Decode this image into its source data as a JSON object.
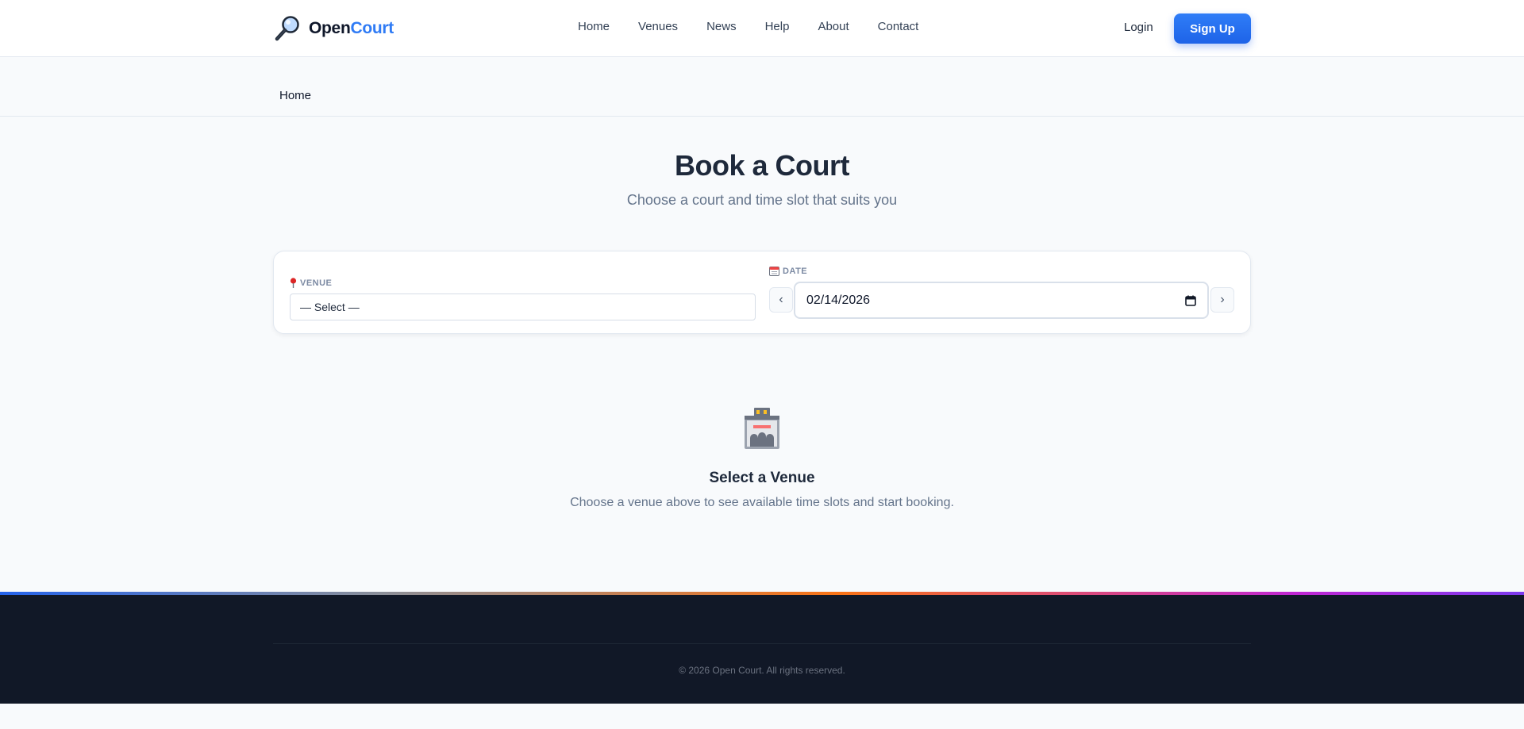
{
  "header": {
    "logo_part1": "Open",
    "logo_part2": "Court",
    "nav": [
      "Home",
      "Venues",
      "News",
      "Help",
      "About",
      "Contact"
    ],
    "login_label": "Login",
    "signup_label": "Sign Up"
  },
  "breadcrumb": {
    "current": "Home"
  },
  "hero": {
    "title": "Book a Court",
    "subtitle": "Choose a court and time slot that suits you"
  },
  "filters": {
    "venue_label": "VENUE",
    "venue_value": "— Select —",
    "date_label": "DATE",
    "date_value": "02/14/2026",
    "prev_label": "‹",
    "next_label": "›"
  },
  "empty_state": {
    "title": "Select a Venue",
    "text": "Choose a venue above to see available time slots and start booking."
  },
  "footer": {
    "copyright": "© 2026 Open Court. All rights reserved."
  },
  "colors": {
    "accent": "#2f7bf5",
    "footer_bg": "#111827",
    "page_bg": "#f8fafc"
  }
}
